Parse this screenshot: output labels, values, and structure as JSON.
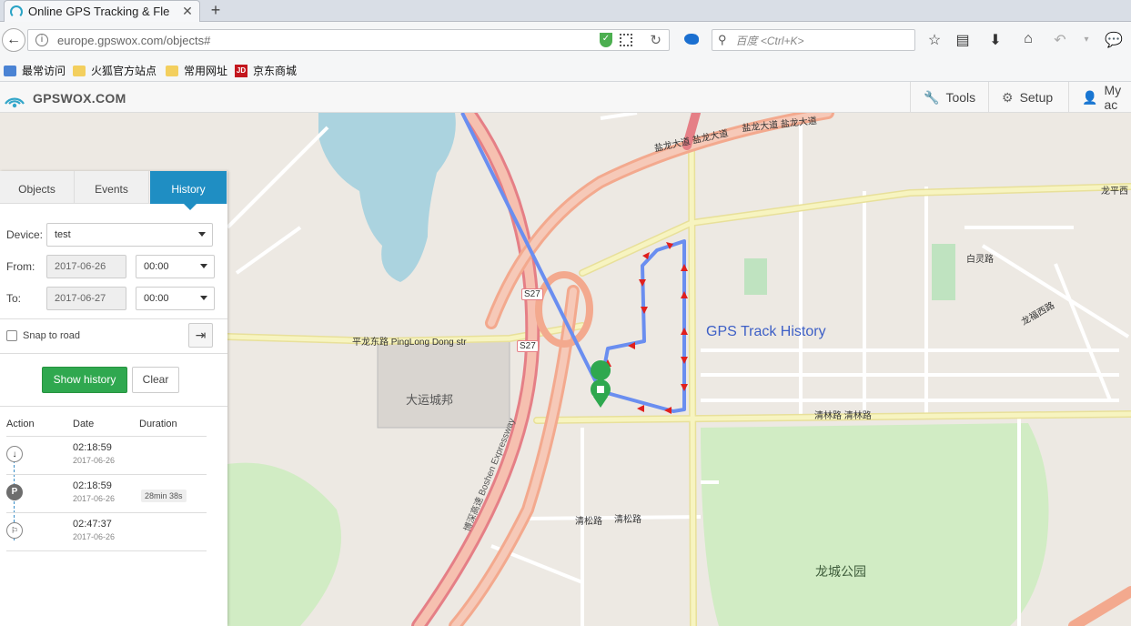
{
  "browser": {
    "tab_title": "Online GPS Tracking & Fle",
    "new_tab": "+",
    "url": "europe.gpswox.com/objects#",
    "search_placeholder": "百度 <Ctrl+K>",
    "bookmarks": [
      {
        "label": "最常访问"
      },
      {
        "label": "火狐官方站点"
      },
      {
        "label": "常用网址"
      },
      {
        "label": "京东商城",
        "badge": "JD"
      }
    ]
  },
  "app": {
    "logo_text": "GPSWOX.COM",
    "nav": {
      "tools": "Tools",
      "setup": "Setup",
      "account": "My ac"
    }
  },
  "panel": {
    "tabs": [
      "Objects",
      "Events",
      "History"
    ],
    "active_tab": "History",
    "device_label": "Device:",
    "device_value": "test",
    "from_label": "From:",
    "from_date": "2017-06-26",
    "from_time": "00:00",
    "to_label": "To:",
    "to_date": "2017-06-27",
    "to_time": "00:00",
    "snap_label": "Snap to road",
    "show_history": "Show history",
    "clear": "Clear",
    "columns": [
      "Action",
      "Date",
      "Duration"
    ],
    "rows": [
      {
        "icon": "download-arrow-icon",
        "time": "02:18:59",
        "date": "2017-06-26",
        "duration": ""
      },
      {
        "icon": "parking-icon",
        "letter": "P",
        "time": "02:18:59",
        "date": "2017-06-26",
        "duration": "28min 38s"
      },
      {
        "icon": "finish-flag-icon",
        "time": "02:47:37",
        "date": "2017-06-26",
        "duration": ""
      }
    ]
  },
  "map": {
    "overlay_title": "GPS Track History",
    "labels": {
      "s27_a": "S27",
      "s27_b": "S27",
      "pinglong": "平龙东路 PingLong Dong str",
      "dayun": "大运城邦",
      "yanlong_1": "盐龙大道 盐龙大道",
      "yanlong_2": "盐龙大道 盐龙大道",
      "longping_west": "龙平西",
      "qinglin": "清林路 清林路",
      "qingsong": "清松路",
      "qingsong_b": "清松路",
      "longcheng_park": "龙城公园",
      "bailong": "白灵路",
      "longfu": "龙福西路",
      "boshen": "博深高速 Boshen Expressway"
    },
    "colors": {
      "track": "#6a8ef0",
      "arrow": "#e0201e",
      "highway": "#f3a98e",
      "highway_red": "#e57f86",
      "major": "#f4f0a4",
      "park": "#d1ecc4",
      "water": "#abd3df"
    }
  }
}
